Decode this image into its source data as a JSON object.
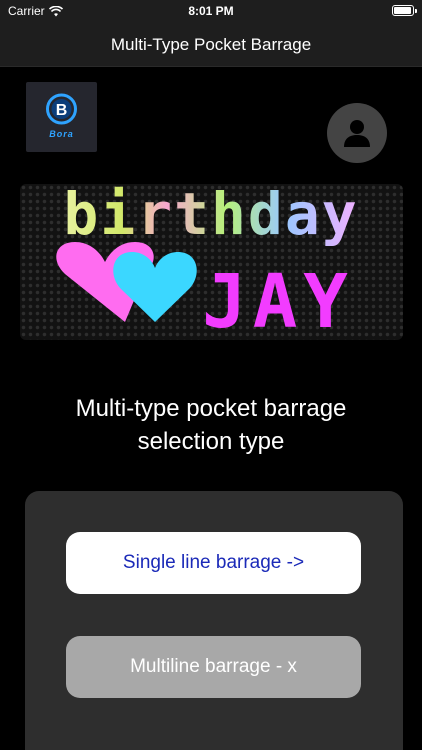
{
  "status_bar": {
    "carrier": "Carrier",
    "time": "8:01 PM",
    "battery_level": 0.95
  },
  "nav": {
    "title": "Multi-Type Pocket Barrage"
  },
  "logo": {
    "text": "Bora",
    "icon": "logo-b-icon"
  },
  "profile": {
    "icon": "person-icon"
  },
  "banner": {
    "line1": "birthday",
    "line2": "JAY",
    "icons": [
      "heart-icon",
      "heart-icon"
    ]
  },
  "heading": {
    "line1": "Multi-type pocket barrage",
    "line2": "selection type"
  },
  "buttons": {
    "single_label": "Single line barrage ->",
    "multi_label": "Multiline barrage - x"
  },
  "colors": {
    "accent_text": "#1b2ab8",
    "panel": "#2e2e2e",
    "disabled_button": "#a8a8a8"
  }
}
